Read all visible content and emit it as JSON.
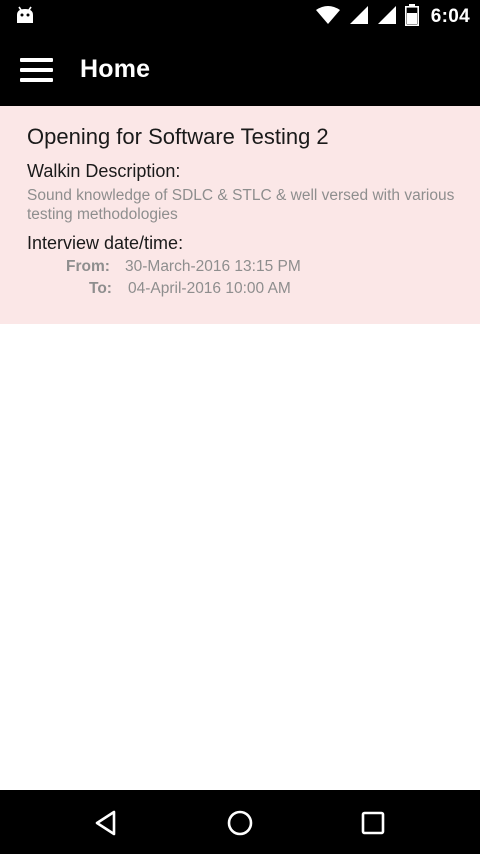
{
  "status_bar": {
    "time": "6:04",
    "icons": [
      "android-icon",
      "wifi-icon",
      "signal-icon",
      "signal-icon",
      "battery-icon"
    ]
  },
  "app_bar": {
    "title": "Home",
    "menu_icon": "hamburger-menu-icon"
  },
  "job": {
    "title": "Opening for Software Testing 2",
    "description_label": "Walkin Description:",
    "description": "Sound knowledge of SDLC & STLC & well versed with various testing methodologies",
    "interview_label": "Interview date/time:",
    "from_label": "From:",
    "from_value": "30-March-2016 13:15 PM",
    "to_label": "To:",
    "to_value": "04-April-2016 10:00 AM"
  },
  "nav_bar": {
    "icons": [
      "back-icon",
      "home-icon",
      "recent-apps-icon"
    ]
  },
  "colors": {
    "bar_background": "#000000",
    "card_background": "#fbe7e7",
    "primary_text": "#1a1a1a",
    "secondary_text": "#8e8e8e"
  }
}
